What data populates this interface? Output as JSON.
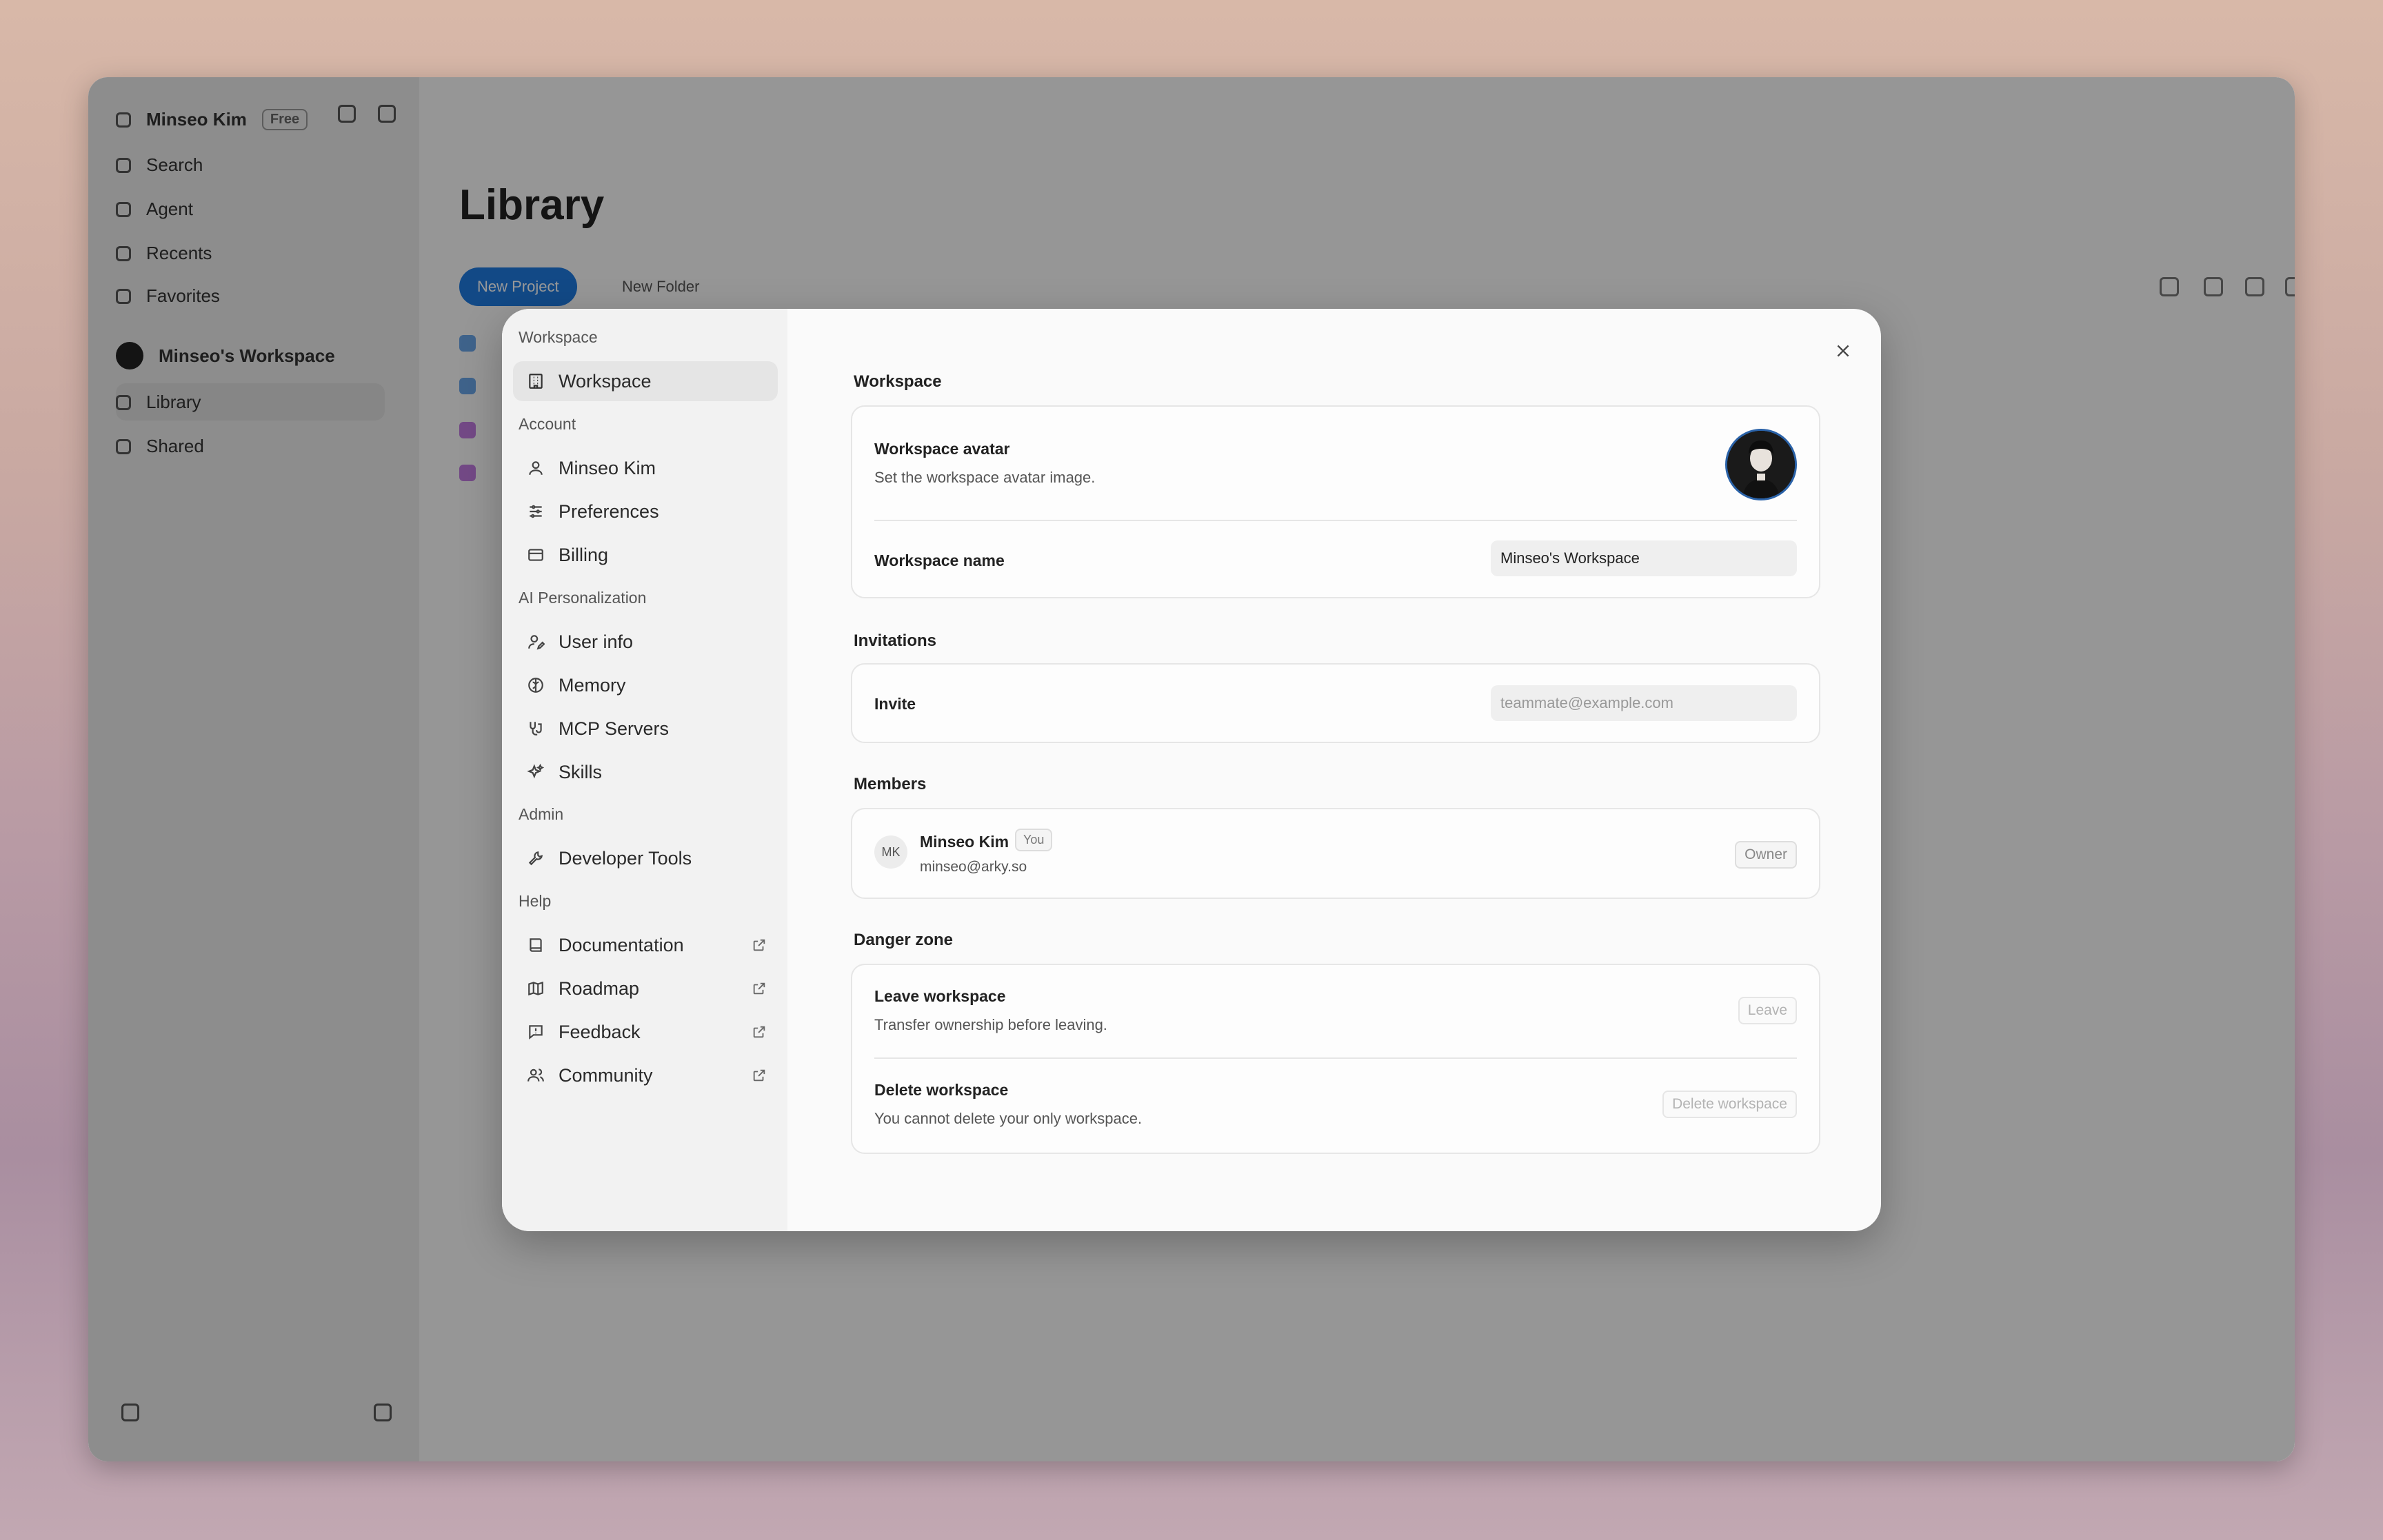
{
  "app": {
    "user_name": "Minseo Kim",
    "plan": "Free",
    "nav": [
      "Search",
      "Agent",
      "Recents",
      "Favorites"
    ],
    "workspace_name": "Minseo's Workspace",
    "workspace_nav": [
      "Library",
      "Shared"
    ],
    "library_title": "Library",
    "new_project": "New Project",
    "new_folder": "New Folder",
    "accent": "#1f7ae0"
  },
  "settings": {
    "sections": [
      {
        "label": "Workspace",
        "items": [
          {
            "label": "Workspace",
            "icon": "building-icon",
            "active": true,
            "external": false
          }
        ]
      },
      {
        "label": "Account",
        "items": [
          {
            "label": "Minseo Kim",
            "icon": "user-icon",
            "external": false
          },
          {
            "label": "Preferences",
            "icon": "sliders-icon",
            "external": false
          },
          {
            "label": "Billing",
            "icon": "credit-card-icon",
            "external": false
          }
        ]
      },
      {
        "label": "AI Personalization",
        "items": [
          {
            "label": "User info",
            "icon": "user-pen-icon",
            "external": false
          },
          {
            "label": "Memory",
            "icon": "brain-icon",
            "external": false
          },
          {
            "label": "MCP Servers",
            "icon": "plug-icon",
            "external": false
          },
          {
            "label": "Skills",
            "icon": "sparkles-icon",
            "external": false
          }
        ]
      },
      {
        "label": "Admin",
        "items": [
          {
            "label": "Developer Tools",
            "icon": "wrench-icon",
            "external": false
          }
        ]
      },
      {
        "label": "Help",
        "items": [
          {
            "label": "Documentation",
            "icon": "book-icon",
            "external": true
          },
          {
            "label": "Roadmap",
            "icon": "map-icon",
            "external": true
          },
          {
            "label": "Feedback",
            "icon": "message-alert-icon",
            "external": true
          },
          {
            "label": "Community",
            "icon": "users-icon",
            "external": true
          }
        ]
      }
    ],
    "workspace": {
      "section_title": "Workspace",
      "avatar_title": "Workspace avatar",
      "avatar_desc": "Set the workspace avatar image.",
      "name_label": "Workspace name",
      "name_value": "Minseo's Workspace"
    },
    "invitations": {
      "section_title": "Invitations",
      "invite_label": "Invite",
      "invite_placeholder": "teammate@example.com"
    },
    "members": {
      "section_title": "Members",
      "list": [
        {
          "initials": "MK",
          "name": "Minseo Kim",
          "badge": "You",
          "email": "minseo@arky.so",
          "role": "Owner"
        }
      ]
    },
    "danger": {
      "section_title": "Danger zone",
      "leave_title": "Leave workspace",
      "leave_desc": "Transfer ownership before leaving.",
      "leave_button": "Leave",
      "delete_title": "Delete workspace",
      "delete_desc": "You cannot delete your only workspace.",
      "delete_button": "Delete workspace"
    }
  }
}
